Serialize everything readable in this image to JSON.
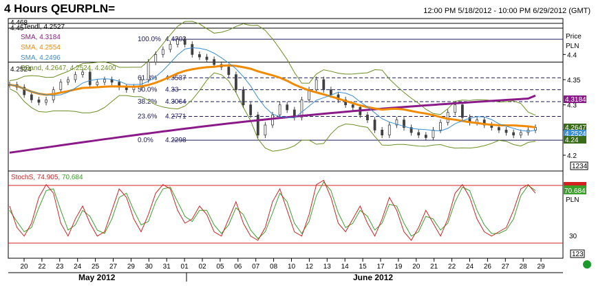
{
  "header": {
    "title": "4 Hours QEURPLN=",
    "range": "12:00 PM 5/18/2012 - 10:00 PM 6/29/2012 (GMT)"
  },
  "legend": {
    "hi": "4.468",
    "trendlines": "4.45",
    "trendlines_label": "Tendl, 4.2527",
    "sma1": "SMA, 4.3184",
    "sma2": "SMA, 4.2554",
    "sma3": "SMA, 4.2496",
    "bband": "BBand, 4.2647, 4.2524, 4.2400",
    "bband_prefix": "4.2524"
  },
  "colors": {
    "price": "#404040",
    "sma1": "#8b1a89",
    "sma2": "#f08a00",
    "sma3": "#3b8ed0",
    "bband": "#6b8e23",
    "stoch_k": "#d42020",
    "stoch_d": "#3aa02a",
    "grid": "#000000",
    "fib": "#1a1a5a"
  },
  "fib": [
    {
      "label": "100.0%",
      "value": "4.4303"
    },
    {
      "label": "61.8%",
      "value": "4.3537"
    },
    {
      "label": "50.0%",
      "value": "4.33"
    },
    {
      "label": "38.2%",
      "value": "4.3064"
    },
    {
      "label": "23.6%",
      "value": "4.2771"
    },
    {
      "label": "0.0%",
      "value": "4.2298"
    }
  ],
  "axis": {
    "price_title": "Price",
    "currency": "PLN",
    "ticks": [
      "4.4",
      "4.35",
      "4.3",
      "4.25",
      "4.2"
    ],
    "box_sma1": "4.3184",
    "box_bb_top": "4.2647",
    "box_bb_mid": "4.2524",
    "box_bb_low": "4.24",
    "box_bottom": "1234",
    "stoch_box": "70.684",
    "stoch_currency": "PLN",
    "stoch_tick": "30",
    "stoch_bottom": "123"
  },
  "stoch": {
    "label": "StochS, 74.905, 70.684",
    "name": "StochS",
    "k": "74.905",
    "d": "70.684"
  },
  "xaxis": {
    "days": [
      "20",
      "22",
      "23",
      "24",
      "25",
      "27",
      "29",
      "30",
      "31",
      "01",
      "02",
      "05",
      "06",
      "07",
      "08",
      "10",
      "12",
      "13",
      "14",
      "15",
      "17",
      "19",
      "20",
      "21",
      "22",
      "24",
      "26",
      "27",
      "28",
      "29"
    ],
    "month1": "May 2012",
    "month2": "June 2012"
  },
  "chart_data": {
    "type": "line",
    "title": "4 Hours QEURPLN=",
    "ylabel": "Price PLN",
    "ylim": [
      4.17,
      4.47
    ],
    "price_close": [
      4.34,
      4.335,
      4.32,
      4.31,
      4.305,
      4.31,
      4.33,
      4.345,
      4.35,
      4.36,
      4.365,
      4.34,
      4.345,
      4.35,
      4.345,
      4.335,
      4.33,
      4.335,
      4.35,
      4.385,
      4.4,
      4.41,
      4.42,
      4.43,
      4.42,
      4.4,
      4.395,
      4.39,
      4.38,
      4.375,
      4.36,
      4.33,
      4.3,
      4.28,
      4.24,
      4.26,
      4.28,
      4.3,
      4.29,
      4.275,
      4.31,
      4.33,
      4.35,
      4.33,
      4.32,
      4.31,
      4.3,
      4.295,
      4.28,
      4.27,
      4.25,
      4.24,
      4.26,
      4.27,
      4.255,
      4.245,
      4.24,
      4.235,
      4.25,
      4.265,
      4.285,
      4.3,
      4.275,
      4.265,
      4.27,
      4.26,
      4.255,
      4.25,
      4.245,
      4.24,
      4.245,
      4.25,
      4.255
    ],
    "sma_long_end": 4.3184,
    "sma_mid_end": 4.2554,
    "sma_short_end": 4.2496,
    "bband_end": [
      4.2647,
      4.2524,
      4.24
    ],
    "stoch_k": [
      60,
      35,
      25,
      40,
      70,
      85,
      75,
      40,
      25,
      45,
      60,
      40,
      25,
      30,
      55,
      80,
      70,
      45,
      30,
      50,
      75,
      85,
      80,
      55,
      40,
      45,
      60,
      50,
      30,
      25,
      45,
      65,
      40,
      25,
      20,
      35,
      65,
      80,
      55,
      30,
      25,
      50,
      85,
      90,
      70,
      40,
      30,
      45,
      60,
      40,
      25,
      45,
      70,
      55,
      30,
      20,
      35,
      55,
      40,
      25,
      45,
      75,
      85,
      70,
      45,
      30,
      25,
      30,
      35,
      55,
      80,
      85,
      75
    ],
    "stoch_d": [
      55,
      42,
      30,
      35,
      58,
      78,
      80,
      55,
      32,
      38,
      55,
      48,
      32,
      28,
      45,
      70,
      75,
      55,
      38,
      42,
      65,
      80,
      82,
      65,
      48,
      42,
      55,
      55,
      38,
      28,
      38,
      58,
      50,
      32,
      22,
      30,
      52,
      75,
      65,
      40,
      28,
      42,
      72,
      88,
      78,
      52,
      35,
      40,
      55,
      48,
      32,
      40,
      62,
      60,
      40,
      25,
      30,
      48,
      45,
      32,
      40,
      65,
      82,
      78,
      55,
      38,
      28,
      28,
      32,
      45,
      72,
      84,
      78
    ],
    "stoch_ylim": [
      0,
      100
    ],
    "stoch_levels": [
      80,
      20
    ]
  }
}
